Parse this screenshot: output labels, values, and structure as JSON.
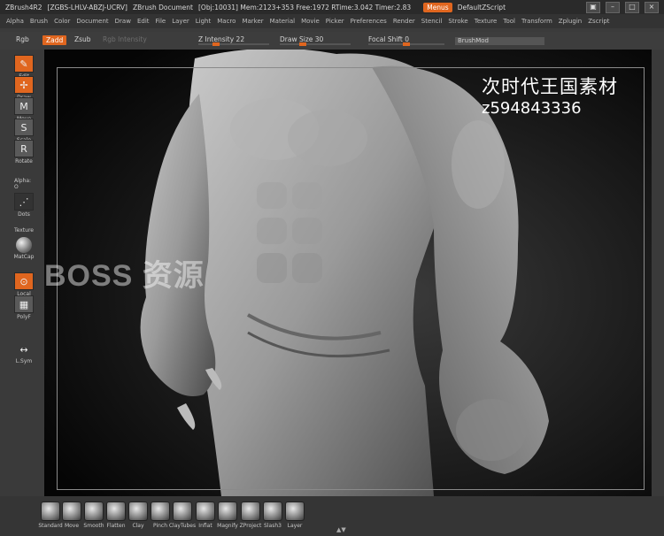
{
  "titlebar": {
    "app": "ZBrush4R2",
    "serial": "[ZGBS-LHLV-ABZJ-UCRV]",
    "doc": "ZBrush Document",
    "stats": "[Obj:10031] Mem:2123+353 Free:1972 RTime:3.042 Timer:2.83",
    "menus_label": "Menus",
    "script_label": "DefaultZScript"
  },
  "menubar": [
    "Alpha",
    "Brush",
    "Color",
    "Document",
    "Draw",
    "Edit",
    "File",
    "Layer",
    "Light",
    "Macro",
    "Marker",
    "Material",
    "Movie",
    "Picker",
    "Preferences",
    "Render",
    "Stencil",
    "Stroke",
    "Texture",
    "Tool",
    "Transform",
    "Zplugin",
    "Zscript"
  ],
  "toolbar": {
    "rgb": "Rgb",
    "zadd": "Zadd",
    "zsub": "Zsub",
    "rgb_intensity": "Rgb Intensity",
    "z_intensity": "Z Intensity 22",
    "draw_size": "Draw Size 30",
    "focal_shift": "Focal Shift 0",
    "brushmod": "BrushMod",
    "z_intensity_level": 0.22,
    "draw_size_level": 0.3,
    "focal_shift_level": 0.5,
    "accent": "#e0661f"
  },
  "left_tools": {
    "edit": "Edit",
    "draw": "Draw",
    "move": "Move",
    "scale": "Scale",
    "rotate": "Rotate",
    "alpha": "Alpha: O",
    "dots": "Dots",
    "texture": "Texture",
    "matcap": "MatCap",
    "local": "Local",
    "polyf": "PolyF",
    "lsym": "L.Sym"
  },
  "watermark": {
    "cn": "次时代王国素材",
    "id": "z594843336",
    "boss": "BOSS 资源"
  },
  "brushes": [
    "Standard",
    "Move",
    "Smooth",
    "Flatten",
    "Clay",
    "Pinch",
    "ClayTubes",
    "Inflat",
    "Magnify",
    "ZProject",
    "Slash3",
    "Layer"
  ]
}
